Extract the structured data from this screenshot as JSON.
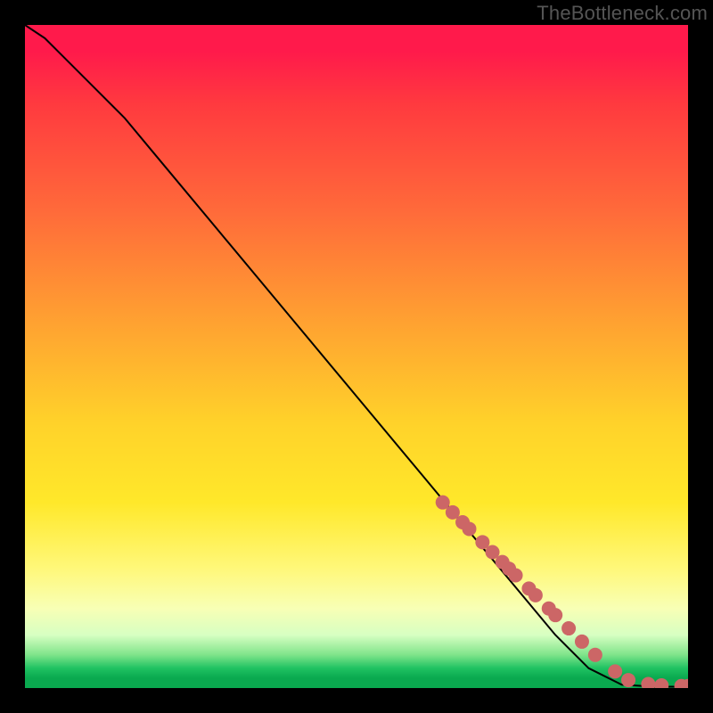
{
  "watermark": "TheBottleneck.com",
  "chart_data": {
    "type": "line",
    "title": "",
    "xlabel": "",
    "ylabel": "",
    "xlim": [
      0,
      100
    ],
    "ylim": [
      0,
      100
    ],
    "series": [
      {
        "name": "curve",
        "x": [
          0,
          3,
          6,
          10,
          15,
          20,
          30,
          40,
          50,
          60,
          70,
          80,
          85,
          90,
          95,
          100
        ],
        "y": [
          100,
          98,
          95,
          91,
          86,
          80,
          68,
          56,
          44,
          32,
          20,
          8,
          3,
          0.5,
          0.2,
          0.2
        ],
        "stroke": "#000000"
      }
    ],
    "points": {
      "name": "dots",
      "color": "#cc6666",
      "radius_relative": 1.0,
      "x": [
        63,
        64.5,
        66,
        67,
        69,
        70.5,
        72,
        73,
        74,
        76,
        77,
        79,
        80,
        82,
        84,
        86,
        89,
        91,
        94,
        96,
        99,
        100
      ],
      "y": [
        28,
        26.5,
        25,
        24,
        22,
        20.5,
        19,
        18,
        17,
        15,
        14,
        12,
        11,
        9,
        7,
        5,
        2.5,
        1.2,
        0.6,
        0.4,
        0.3,
        0.3
      ]
    }
  }
}
